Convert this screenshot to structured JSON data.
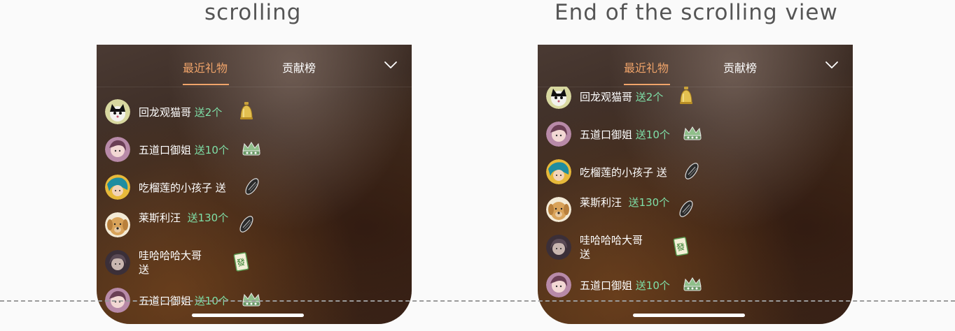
{
  "captions": {
    "left": "scrolling",
    "right": "End of the scrolling view"
  },
  "tabs": {
    "recent": "最近礼物",
    "rank": "贡献榜"
  },
  "colors": {
    "accent": "#f0a46a",
    "gift_text": "#7fe0a8",
    "caption": "#555555"
  },
  "left_list": [
    {
      "name": "回龙观猫哥",
      "gift": "送2个",
      "gift_icon": "gold-bell-icon"
    },
    {
      "name": "五道口御姐",
      "gift": "送10个",
      "gift_icon": "crown-icon"
    },
    {
      "name": "吃榴莲的小孩子",
      "gift": "送",
      "gift_icon": "sunflower-seed-icon"
    },
    {
      "name": "莱斯利汪",
      "gift": "送130个",
      "gift_icon": "sunflower-seed-icon"
    },
    {
      "name": "哇哈哈哈大哥",
      "gift": "送",
      "gift_icon": "mahjong-tile-icon"
    },
    {
      "name": "五道口御姐",
      "gift": "送10个",
      "gift_icon": "crown-icon"
    }
  ],
  "right_list": [
    {
      "name": "回龙观猫哥",
      "gift": "送2个",
      "gift_icon": "gold-bell-icon"
    },
    {
      "name": "五道口御姐",
      "gift": "送10个",
      "gift_icon": "crown-icon"
    },
    {
      "name": "吃榴莲的小孩子",
      "gift": "送",
      "gift_icon": "sunflower-seed-icon"
    },
    {
      "name": "莱斯利汪",
      "gift": "送130个",
      "gift_icon": "sunflower-seed-icon"
    },
    {
      "name": "哇哈哈哈大哥",
      "gift": "送",
      "gift_icon": "mahjong-tile-icon"
    },
    {
      "name": "五道口御姐",
      "gift": "送10个",
      "gift_icon": "crown-icon"
    }
  ]
}
